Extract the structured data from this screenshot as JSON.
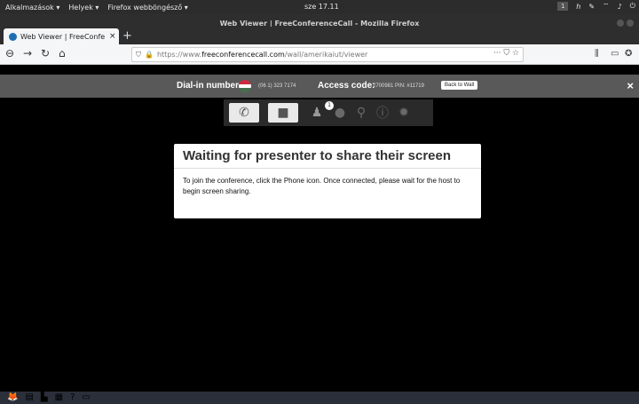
{
  "top_panel": {
    "menu_apps": "Alkalmazások ▾",
    "menu_places": "Helyek ▾",
    "menu_browser": "Firefox webböngésző ▾",
    "clock": "sze 17.11",
    "workspace": "1"
  },
  "window": {
    "title": "Web Viewer | FreeConferenceCall - Mozilla Firefox"
  },
  "tab": {
    "label": "Web Viewer | FreeConfe",
    "close": "×",
    "new": "+"
  },
  "nav": {
    "url_prefix": "https://www.",
    "url_host": "freeconferencecall.com",
    "url_path": "/wall/amerikaiut/viewer",
    "url_actions": "··· ⛉ ☆"
  },
  "dialin": {
    "label": "Dial-in number:",
    "number": "(06 1) 323 7174",
    "access_label": "Access code:",
    "access_value": "2700981 PIN: #11719",
    "back_button": "Back to Wall",
    "close": "×",
    "flag_colors": [
      "#cd2a3e",
      "#ffffff",
      "#436f4d"
    ]
  },
  "toolbar": {
    "participants_badge": "1"
  },
  "dialog": {
    "title": "Waiting for presenter to share their screen",
    "body": "To join the conference, click the Phone icon. Once connected, please wait for the host to begin screen sharing."
  }
}
